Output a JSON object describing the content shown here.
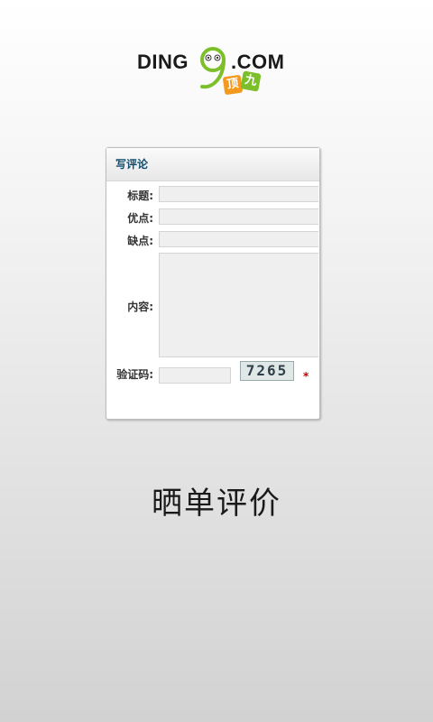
{
  "logo": {
    "left_text": "DING",
    "right_text": ".COM",
    "tag1": "顶",
    "tag2": "九"
  },
  "form": {
    "title": "写评论",
    "fields": {
      "title_label": "标题:",
      "pros_label": "优点:",
      "cons_label": "缺点:",
      "content_label": "内容:",
      "captcha_label": "验证码:"
    },
    "captcha_text": "7265",
    "required_mark": "*"
  },
  "caption": "晒单评价",
  "colors": {
    "title_blue": "#0f4c6e",
    "required_red": "#c40000",
    "logo_orange": "#f39a1e",
    "logo_green": "#7cbf2b"
  }
}
